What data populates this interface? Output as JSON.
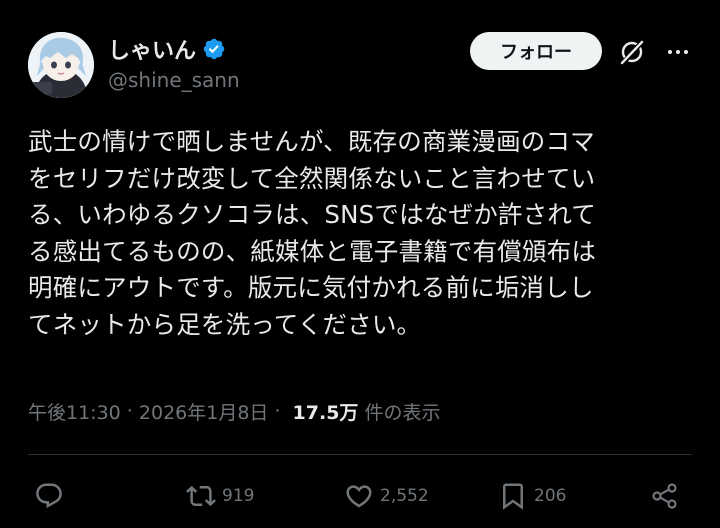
{
  "author": {
    "display_name": "しゃいん",
    "handle": "@shine_sann",
    "verified": true,
    "verified_color": "#1d9bf0"
  },
  "header": {
    "follow_label": "フォロー",
    "icons": [
      "grok-icon",
      "more-icon"
    ]
  },
  "tweet": {
    "lines": [
      "武士の情けで晒しませんが、既存の商業漫画のコマ",
      "をセリフだけ改変して全然関係ないこと言わせてい",
      "る、いわゆるクソコラは、SNSではなぜか許されて",
      "る感出てるものの、紙媒体と電子書籍で有償頒布は",
      "明確にアウトです。版元に気付かれる前に垢消しし",
      "てネットから足を洗ってください。"
    ]
  },
  "meta": {
    "time": "午後11:30",
    "sep1": " · ",
    "date": "2026年1月8日",
    "sep2": " · ",
    "views": "17.5万",
    "views_label": "件の表示"
  },
  "actions": {
    "reply_count": "",
    "retweet_count": "919",
    "like_count": "2,552",
    "bookmark_count": "206"
  },
  "colors": {
    "background": "#000000",
    "text": "#e7e9ea",
    "muted": "#71767b",
    "divider": "#2f3336"
  }
}
